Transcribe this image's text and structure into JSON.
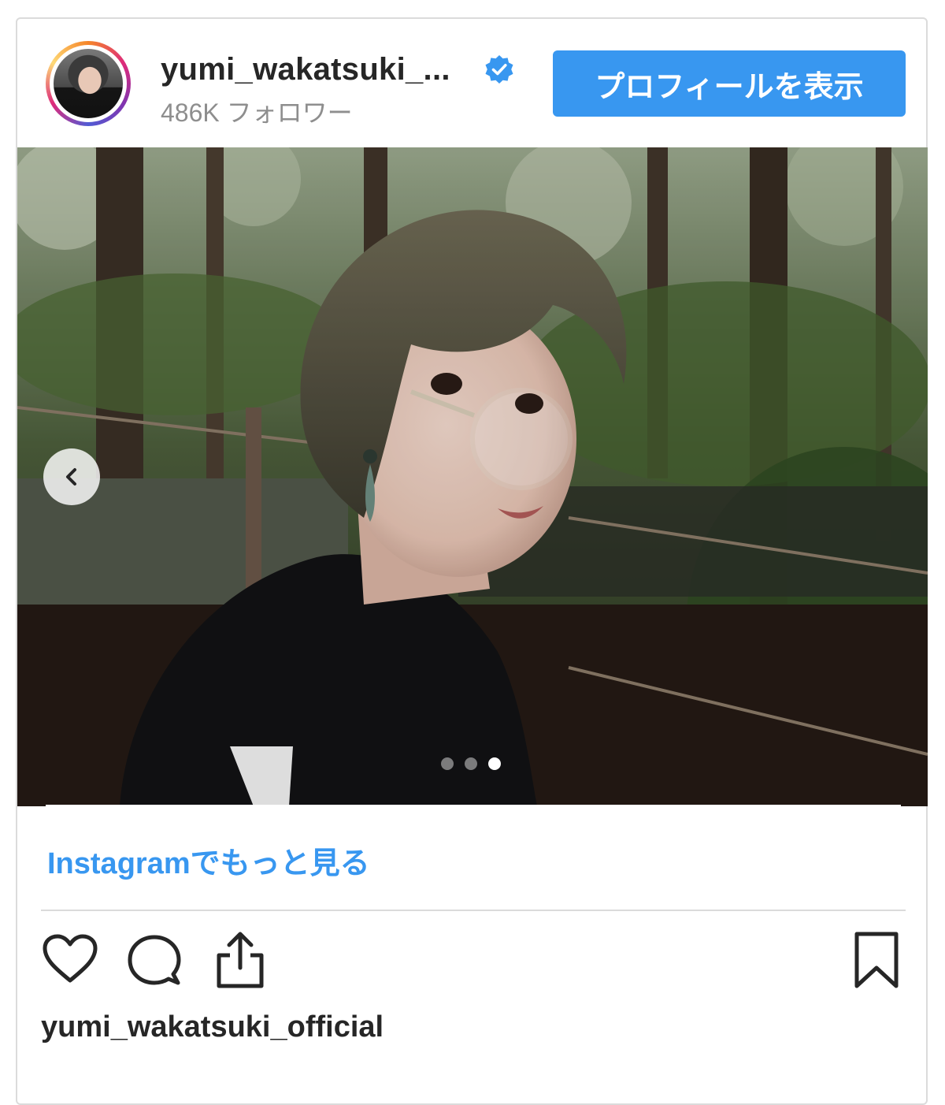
{
  "header": {
    "username": "yumi_wakatsuki_...",
    "followers": "486K フォロワー",
    "profile_button": "プロフィールを表示"
  },
  "carousel": {
    "total_slides": 3,
    "active_slide": 3
  },
  "links": {
    "more_on_instagram": "Instagramでもっと見る"
  },
  "footer": {
    "username": "yumi_wakatsuki_official"
  },
  "icons": {
    "verified": "verified-badge-icon",
    "prev": "chevron-left-icon",
    "like": "heart-icon",
    "comment": "comment-icon",
    "share": "share-icon",
    "save": "bookmark-icon"
  },
  "colors": {
    "accent": "#3897f0",
    "text": "#262626",
    "muted": "#8e8e8e",
    "border": "#dbdbdb"
  }
}
